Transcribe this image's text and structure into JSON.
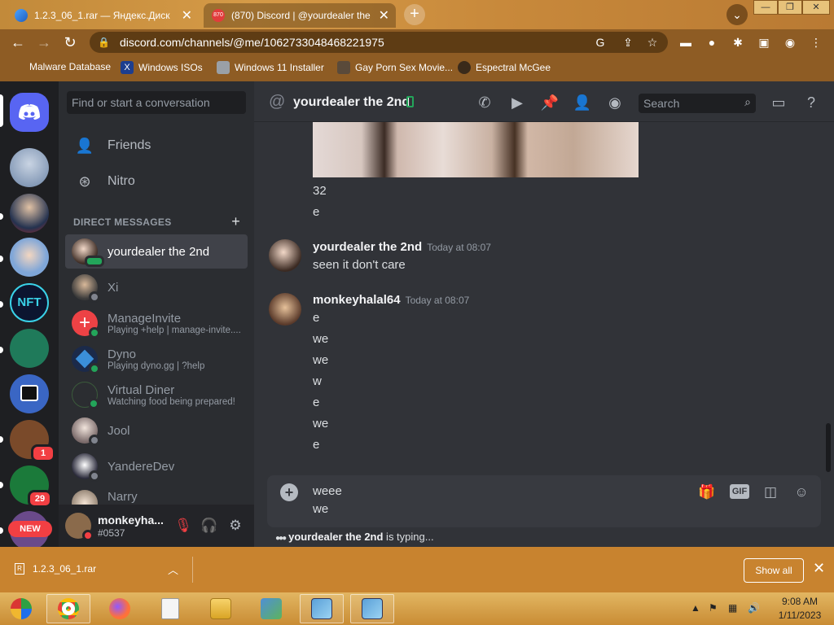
{
  "browser": {
    "tabs": [
      {
        "title": "1.2.3_06_1.rar — Яндекс.Диск",
        "active": false
      },
      {
        "title": "(870) Discord | @yourdealer the",
        "active": true
      }
    ],
    "tab_badge": "870",
    "new_tab": "+",
    "window_controls": [
      "—",
      "❐",
      "✕"
    ],
    "url": "discord.com/channels/@me/1062733048468221975",
    "bookmarks": [
      "Malware Database",
      "Windows ISOs",
      "Windows 11 Installer",
      "Gay Porn Sex Movie...",
      "Espectral McGee"
    ]
  },
  "servers": {
    "badges": [
      "1",
      "29"
    ],
    "new_label": "NEW"
  },
  "dm": {
    "search_placeholder": "Find or start a conversation",
    "nav": [
      {
        "label": "Friends",
        "icon": "friends-icon"
      },
      {
        "label": "Nitro",
        "icon": "nitro-icon"
      }
    ],
    "header": "DIRECT MESSAGES",
    "items": [
      {
        "name": "yourdealer the 2nd",
        "sub": "",
        "active": true
      },
      {
        "name": "Xi",
        "sub": ""
      },
      {
        "name": "ManageInvite",
        "sub": "Playing +help | manage-invite...."
      },
      {
        "name": "Dyno",
        "sub": "Playing dyno.gg | ?help"
      },
      {
        "name": "Virtual Diner",
        "sub": "Watching food being prepared!"
      },
      {
        "name": "Jool",
        "sub": ""
      },
      {
        "name": "YandereDev",
        "sub": ""
      },
      {
        "name": "Narry",
        "sub": ""
      }
    ]
  },
  "user": {
    "name": "monkeyha...",
    "tag": "#0537"
  },
  "chat": {
    "channel_name": "yourdealer the 2nd",
    "search_placeholder": "Search",
    "pre_lines": [
      "32",
      "e"
    ],
    "messages": [
      {
        "author": "yourdealer the 2nd",
        "time": "Today at 08:07",
        "lines": [
          "seen it don't care"
        ]
      },
      {
        "author": "monkeyhalal64",
        "time": "Today at 08:07",
        "lines": [
          "e",
          "we",
          "we",
          "w",
          "e",
          "we",
          "e"
        ]
      }
    ],
    "composer_lines": [
      "weee",
      "we"
    ],
    "typing_user": "yourdealer the 2nd",
    "typing_suffix": " is typing..."
  },
  "downloads": {
    "file": "1.2.3_06_1.rar",
    "show_all": "Show all"
  },
  "taskbar": {
    "time": "9:08 AM",
    "date": "1/11/2023"
  }
}
